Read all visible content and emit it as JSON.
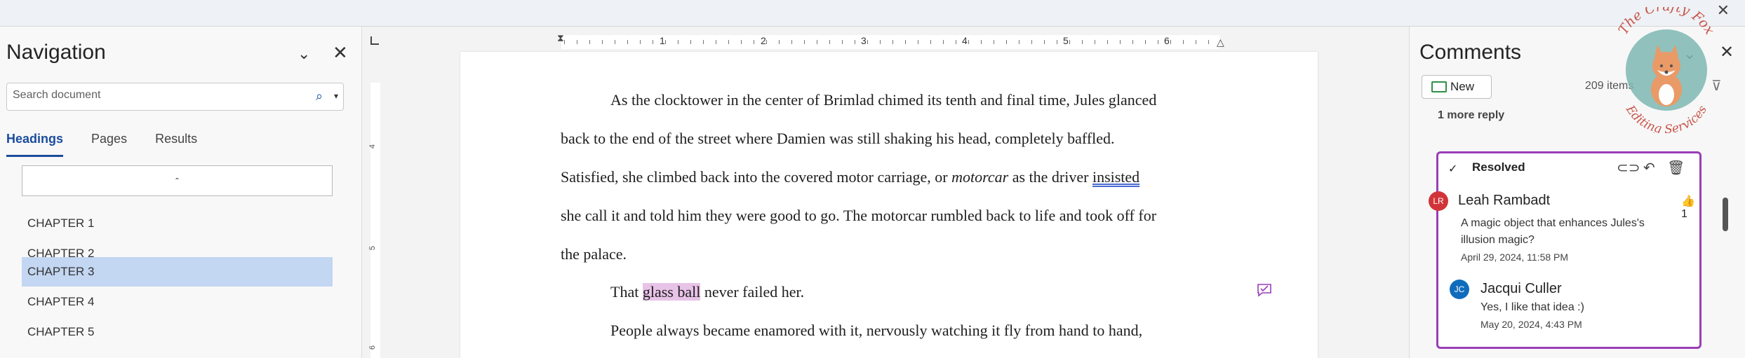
{
  "window": {
    "close_glyph": "✕"
  },
  "navigation": {
    "title": "Navigation",
    "search_placeholder": "Search document",
    "tabs": [
      "Headings",
      "Pages",
      "Results"
    ],
    "collapse_glyph": "ˆ",
    "headings": [
      {
        "label": "CHAPTER 1",
        "selected": false
      },
      {
        "label": "CHAPTER 2",
        "selected": false
      },
      {
        "label": "CHAPTER 3",
        "selected": true
      },
      {
        "label": "CHAPTER 4",
        "selected": false
      },
      {
        "label": "CHAPTER 5",
        "selected": false
      }
    ]
  },
  "ruler": {
    "horizontal": [
      "1",
      "2",
      "3",
      "4",
      "5",
      "6"
    ],
    "vertical": [
      "4",
      "5",
      "6"
    ]
  },
  "document": {
    "lines": [
      "As the clocktower in the center of Brimlad chimed its tenth and final time, Jules glanced",
      "back to the end of the street where Damien was still shaking his head, completely baffled.",
      "Satisfied, she climbed back into the covered motor carriage, or ",
      "motorcar",
      " as the driver ",
      "insisted",
      "she call it and told him they were good to go. The motorcar rumbled back to life and took off for",
      "the palace.",
      "That ",
      "glass ball",
      " never failed her.",
      "People always became enamored with it, nervously watching it fly from hand to hand,"
    ]
  },
  "comments": {
    "title": "Comments",
    "new_label": "New",
    "items_count": "209 items",
    "more_reply": "1 more reply",
    "thread": {
      "status": "Resolved",
      "like_count": "1",
      "first": {
        "initials": "LR",
        "author": "Leah Rambadt",
        "body_line1": "A magic object that enhances Jules's",
        "body_line2": "illusion magic?",
        "date": "April 29, 2024, 11:58 PM",
        "avatar_color": "#d13438"
      },
      "reply": {
        "initials": "JC",
        "author": "Jacqui Culler",
        "body": "Yes, I like that idea :)",
        "date": "May 20, 2024, 4:43 PM",
        "avatar_color": "#0f6cbd"
      }
    }
  },
  "watermark": {
    "line1": "The Crafty Fox",
    "line2": "Editing Services"
  }
}
